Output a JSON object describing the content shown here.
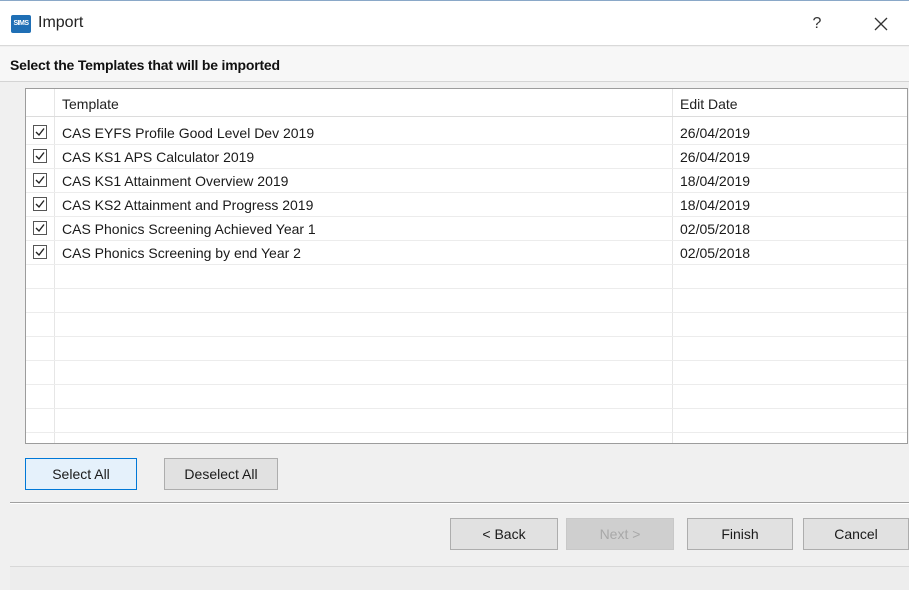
{
  "window": {
    "title": "Import",
    "icon": "app-logo-icon",
    "help_label": "?",
    "close_icon": "close-icon"
  },
  "header": {
    "instruction": "Select the Templates that will be imported"
  },
  "table": {
    "columns": [
      "Template",
      "Edit Date"
    ],
    "rows": [
      {
        "checked": true,
        "template": "CAS EYFS Profile Good Level Dev 2019",
        "edit_date": "26/04/2019"
      },
      {
        "checked": true,
        "template": "CAS KS1 APS Calculator 2019",
        "edit_date": "26/04/2019"
      },
      {
        "checked": true,
        "template": "CAS KS1 Attainment Overview 2019",
        "edit_date": "18/04/2019"
      },
      {
        "checked": true,
        "template": "CAS KS2 Attainment and Progress 2019",
        "edit_date": "18/04/2019"
      },
      {
        "checked": true,
        "template": "CAS Phonics Screening Achieved Year 1",
        "edit_date": "02/05/2018"
      },
      {
        "checked": true,
        "template": "CAS Phonics Screening by end Year 2",
        "edit_date": "02/05/2018"
      }
    ]
  },
  "selection_buttons": {
    "select_all": "Select All",
    "deselect_all": "Deselect All"
  },
  "wizard_buttons": {
    "back": "< Back",
    "next": "Next >",
    "finish": "Finish",
    "cancel": "Cancel"
  },
  "colors": {
    "focus_border": "#0078d7",
    "app_icon": "#1f6fb5"
  }
}
